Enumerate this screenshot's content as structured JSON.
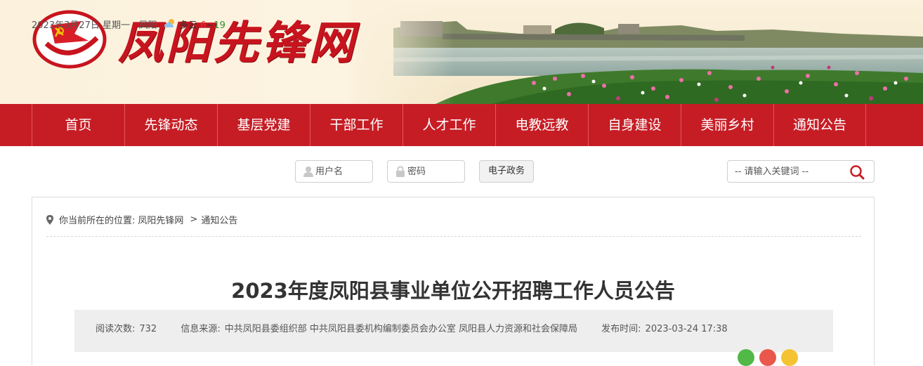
{
  "header": {
    "site_title": "凤阳先锋网",
    "colors": {
      "brand_red": "#c61d25",
      "banner_bg": "#fbf1dc"
    }
  },
  "nav": {
    "items": [
      {
        "label": "首页"
      },
      {
        "label": "先锋动态"
      },
      {
        "label": "基层党建"
      },
      {
        "label": "干部工作"
      },
      {
        "label": "人才工作"
      },
      {
        "label": "电教远教"
      },
      {
        "label": "自身建设"
      },
      {
        "label": "美丽乡村"
      },
      {
        "label": "通知公告"
      }
    ]
  },
  "infobar": {
    "date": "2023年3月27日 星期一",
    "city": "凤阳",
    "weather": "多云",
    "temp_low": "6",
    "temp_sep": "~",
    "temp_high": "19",
    "weather_icon": "cloud-sun-icon"
  },
  "login": {
    "username_placeholder": "用户名",
    "password_placeholder": "密码",
    "gov_button": "电子政务"
  },
  "search": {
    "placeholder": "-- 请输入关键词 --",
    "icon": "search-icon"
  },
  "breadcrumb": {
    "prefix": "你当前所在的位置:",
    "home": "凤阳先锋网",
    "separator": ">",
    "current": "通知公告"
  },
  "article": {
    "title": "2023年度凤阳县事业单位公开招聘工作人员公告",
    "views_label": "阅读次数:",
    "views": "732",
    "source_label": "信息来源:",
    "source": "中共凤阳县委组织部 中共凤阳县委机构编制委员会办公室 凤阳县人力资源和社会保障局",
    "published_label": "发布时间:",
    "published": "2023-03-24 17:38"
  },
  "share": {
    "colors": [
      "#52b848",
      "#e9584b",
      "#f4c233"
    ]
  }
}
